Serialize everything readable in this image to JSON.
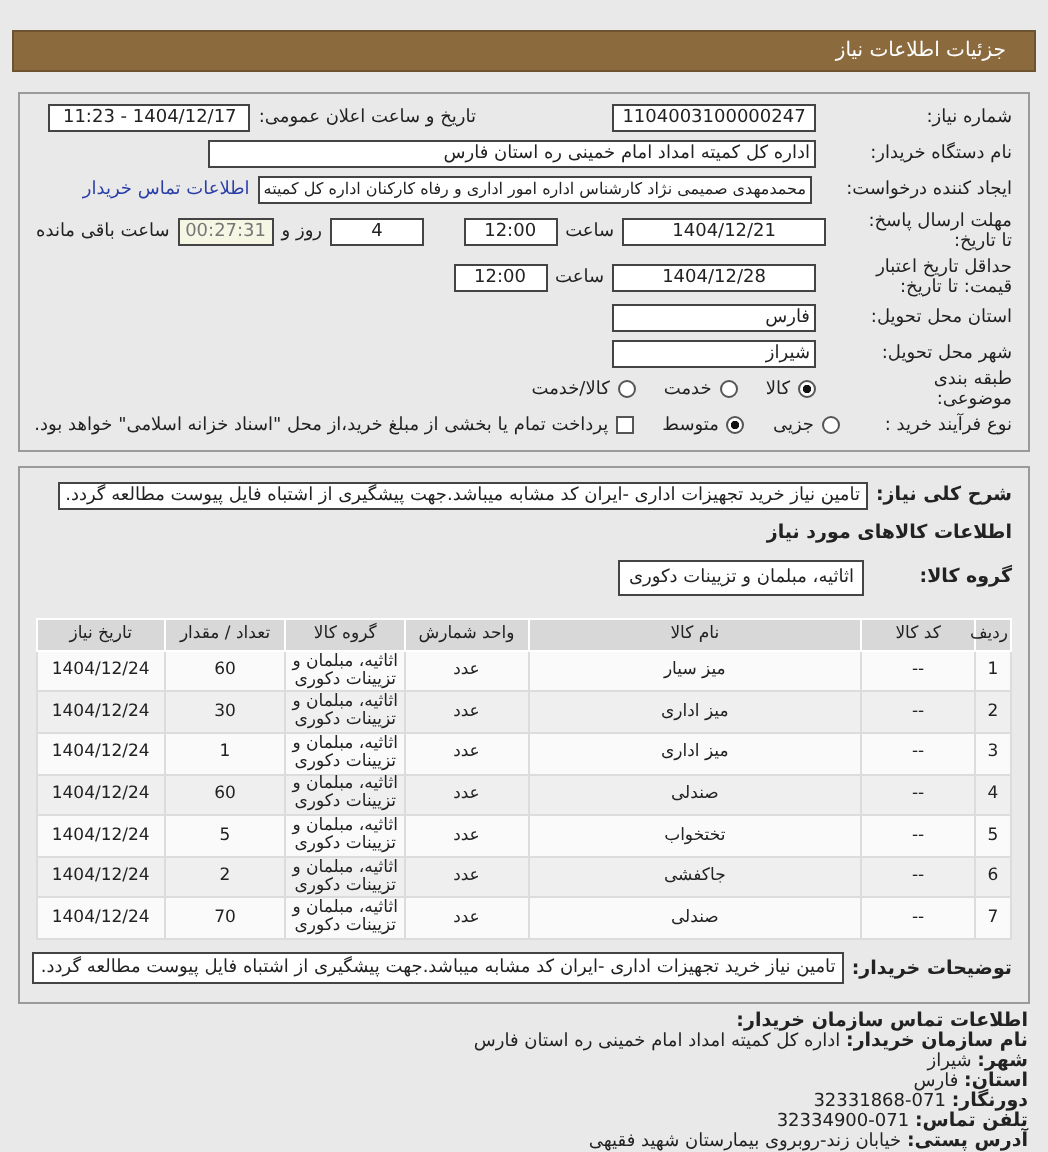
{
  "header": {
    "title": "جزئیات اطلاعات نیاز"
  },
  "need_number": {
    "label": "شماره نیاز:",
    "value": "1104003100000247"
  },
  "announce": {
    "label": "تاریخ و ساعت اعلان عمومی:",
    "value": "1404/12/17 - 11:23"
  },
  "buyer_org": {
    "label": "نام دستگاه خریدار:",
    "value": "اداره کل کمیته امداد امام خمینی  ره  استان فارس"
  },
  "requester": {
    "label": "ایجاد کننده درخواست:",
    "value": "محمدمهدی صمیمی نژاد کارشناس اداره امور اداری و رفاه کارکنان اداره کل کمیته",
    "link": "اطلاعات تماس خریدار"
  },
  "deadline": {
    "label": "مهلت ارسال پاسخ: تا تاریخ:",
    "date": "1404/12/21",
    "time_label": "ساعت",
    "time": "12:00",
    "days": "4",
    "days_label": "روز و",
    "remaining": "00:27:31",
    "remaining_label": "ساعت باقی مانده"
  },
  "validity": {
    "label": "حداقل تاریخ اعتبار قیمت: تا تاریخ:",
    "date": "1404/12/28",
    "time_label": "ساعت",
    "time": "12:00"
  },
  "province": {
    "label": "استان محل تحویل:",
    "value": "فارس"
  },
  "city": {
    "label": "شهر محل تحویل:",
    "value": "شیراز"
  },
  "category": {
    "label": "طبقه بندی موضوعی:",
    "options": [
      {
        "label": "کالا",
        "selected": true
      },
      {
        "label": "خدمت",
        "selected": false
      },
      {
        "label": "کالا/خدمت",
        "selected": false
      }
    ]
  },
  "process": {
    "label": "نوع فرآیند خرید :",
    "options": [
      {
        "label": "جزیی",
        "selected": false
      },
      {
        "label": "متوسط",
        "selected": true
      }
    ],
    "treasury": {
      "label": "پرداخت تمام یا بخشی از مبلغ خرید،از محل \"اسناد خزانه اسلامی\" خواهد بود.",
      "checked": false
    }
  },
  "summary": {
    "label": "شرح کلی نیاز:",
    "value": "تامین نیاز خرید تجهیزات اداری -ایران کد مشابه میباشد.جهت پیشگیری از اشتباه فایل پیوست مطالعه گردد."
  },
  "goods_title": "اطلاعات کالاهای مورد نیاز",
  "goods_group": {
    "label": "گروه کالا:",
    "value": "اثاثیه، مبلمان و تزیینات دکوری"
  },
  "table": {
    "columns": [
      "ردیف",
      "کد کالا",
      "نام کالا",
      "واحد شمارش",
      "گروه کالا",
      "تعداد / مقدار",
      "تاریخ نیاز"
    ],
    "rows": [
      [
        "1",
        "--",
        "میز سیار",
        "عدد",
        "اثاثیه، مبلمان و تزیینات دکوری",
        "60",
        "1404/12/24"
      ],
      [
        "2",
        "--",
        "میز اداری",
        "عدد",
        "اثاثیه، مبلمان و تزیینات دکوری",
        "30",
        "1404/12/24"
      ],
      [
        "3",
        "--",
        "میز اداری",
        "عدد",
        "اثاثیه، مبلمان و تزیینات دکوری",
        "1",
        "1404/12/24"
      ],
      [
        "4",
        "--",
        "صندلی",
        "عدد",
        "اثاثیه، مبلمان و تزیینات دکوری",
        "60",
        "1404/12/24"
      ],
      [
        "5",
        "--",
        "تختخواب",
        "عدد",
        "اثاثیه، مبلمان و تزیینات دکوری",
        "5",
        "1404/12/24"
      ],
      [
        "6",
        "--",
        "جاکفشی",
        "عدد",
        "اثاثیه، مبلمان و تزیینات دکوری",
        "2",
        "1404/12/24"
      ],
      [
        "7",
        "--",
        "صندلی",
        "عدد",
        "اثاثیه، مبلمان و تزیینات دکوری",
        "70",
        "1404/12/24"
      ]
    ]
  },
  "buyer_notes": {
    "label": "توضیحات خریدار:",
    "value": "تامین نیاز خرید تجهیزات اداری -ایران کد مشابه میباشد.جهت پیشگیری از اشتباه فایل پیوست مطالعه گردد."
  },
  "contact": {
    "title": "اطلاعات تماس سازمان خریدار:",
    "lines": [
      {
        "label": "نام سازمان خریدار:",
        "value": "اداره کل کمیته امداد امام خمینی ره استان فارس"
      },
      {
        "label": "شهر:",
        "value": "شیراز"
      },
      {
        "label": "استان:",
        "value": "فارس"
      },
      {
        "label": "دورنگار:",
        "value": "071-32331868"
      },
      {
        "label": "تلفن تماس:",
        "value": "071-32334900"
      },
      {
        "label": "آدرس پستی:",
        "value": "خیابان زند-روبروی بیمارستان شهید فقیهی"
      }
    ]
  }
}
